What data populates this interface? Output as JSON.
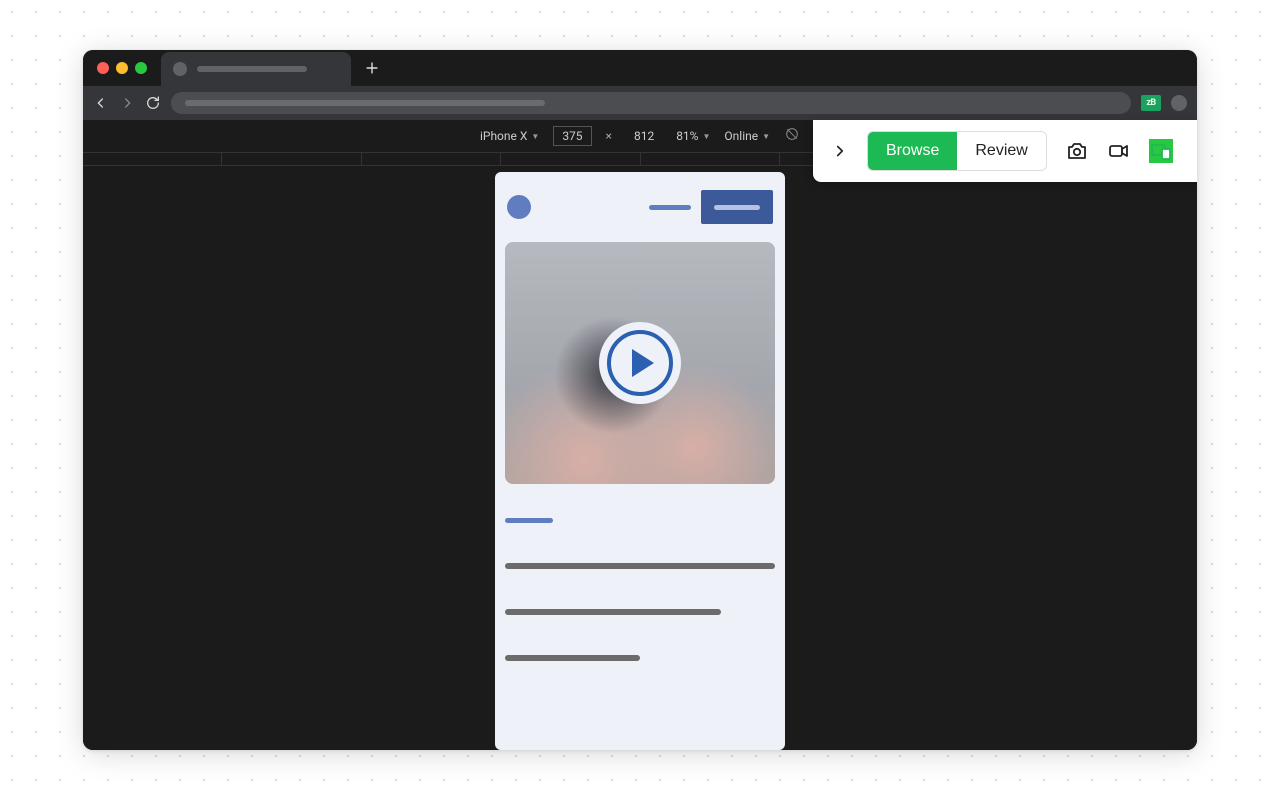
{
  "devtools": {
    "device": "iPhone X",
    "width": "375",
    "height": "812",
    "zoom": "81%",
    "network": "Online"
  },
  "extension": {
    "badge": "zB"
  },
  "overlay": {
    "browse": "Browse",
    "review": "Review"
  }
}
